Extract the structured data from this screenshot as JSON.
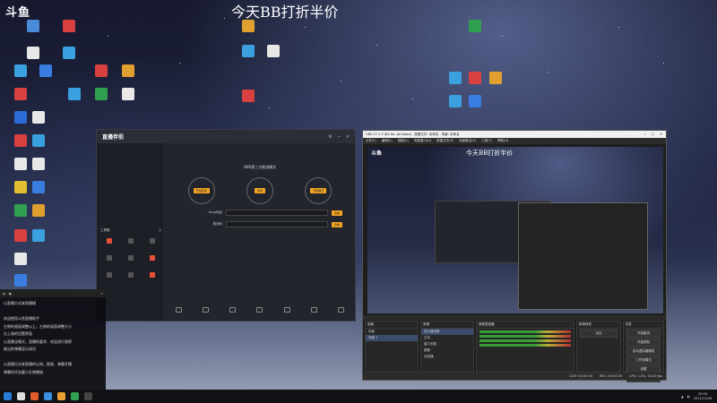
{
  "desktop": {
    "logo": "斗鱼",
    "stream_title": "今天BB打折半价"
  },
  "desktop_icons": [
    {
      "icon": "app-icon",
      "color": "#4a8bd8"
    },
    {
      "icon": "app-icon",
      "color": "#d94040"
    },
    {
      "icon": "app-icon",
      "color": "#e8e8e8"
    },
    {
      "icon": "app-icon",
      "color": "#3aa0e0"
    },
    {
      "icon": "app-icon",
      "color": "#d94040"
    },
    {
      "icon": "app-icon",
      "color": "#e0a030"
    },
    {
      "icon": "app-icon",
      "color": "#3aa0e0"
    },
    {
      "icon": "app-icon",
      "color": "#3a7de0"
    },
    {
      "icon": "app-icon",
      "color": "#30a050"
    },
    {
      "icon": "app-icon",
      "color": "#e8e8e8"
    },
    {
      "icon": "app-icon",
      "color": "#d94040"
    },
    {
      "icon": "app-icon",
      "color": "#3aa0e0"
    },
    {
      "icon": "app-icon",
      "color": "#2b6cd6"
    },
    {
      "icon": "app-icon",
      "color": "#e8e8e8"
    },
    {
      "icon": "app-icon",
      "color": "#d94040"
    },
    {
      "icon": "app-icon",
      "color": "#3aa0e0"
    },
    {
      "icon": "app-icon",
      "color": "#e8e8e8"
    },
    {
      "icon": "app-icon",
      "color": "#e8e8e8"
    },
    {
      "icon": "app-icon",
      "color": "#e0c030"
    },
    {
      "icon": "app-icon",
      "color": "#3a7de0"
    },
    {
      "icon": "app-icon",
      "color": "#30a050"
    },
    {
      "icon": "app-icon",
      "color": "#e0a030"
    },
    {
      "icon": "app-icon",
      "color": "#d94040"
    },
    {
      "icon": "app-icon",
      "color": "#3aa0e0"
    },
    {
      "icon": "app-icon",
      "color": "#e8e8e8"
    },
    {
      "icon": "app-icon",
      "color": "#3a7de0"
    },
    {
      "icon": "app-icon",
      "color": "#e0a030"
    },
    {
      "icon": "app-icon",
      "color": "#3aa0e0"
    },
    {
      "icon": "app-icon",
      "color": "#e8e8e8"
    },
    {
      "icon": "app-icon",
      "color": "#d94040"
    },
    {
      "icon": "app-icon",
      "color": "#30a050"
    }
  ],
  "streaming_app": {
    "logo": "直播伴侣",
    "mode_title": "OBS第三方推流模式",
    "steps": [
      {
        "button": "开始直播"
      },
      {
        "button": "复制"
      },
      {
        "button": "开始推流"
      }
    ],
    "fields": [
      {
        "key": "rtmp地址",
        "button": "复制"
      },
      {
        "key": "推流码",
        "button": "复制"
      }
    ],
    "tools_title": "工具箱"
  },
  "obs": {
    "title": "OBS 27.1.3 (64-bit, windows) - 配置文件: 未命名 - 场景: 未命名",
    "menu": [
      "文件(F)",
      "编辑(E)",
      "视图(V)",
      "停靠窗口(D)",
      "配置文件(P)",
      "场景集合(S)",
      "工具(T)",
      "帮助(H)"
    ],
    "preview_title": "今天BB打折半价",
    "preview_logo": "斗鱼",
    "docks": {
      "scenes_header": "场景",
      "scenes": [
        "场景",
        "场景 2"
      ],
      "sources_header": "来源",
      "sources": [
        "显示器采集",
        "文本",
        "窗口采集",
        "图像",
        "浏览器"
      ],
      "mixer_header": "音频混音器",
      "transitions_header": "转场特效",
      "transition_value": "淡出",
      "controls_header": "控件",
      "controls": [
        "开始推流",
        "开始录制",
        "启动虚拟摄像机",
        "工作室模式",
        "设置",
        "退出"
      ]
    },
    "status": [
      "LIVE: 00:00:00",
      "REC: 00:00:00",
      "CPU: 1.0%, 30.00 fps"
    ]
  },
  "chat": {
    "lines": [
      "以直播方式来直播模",
      "",
      "欢迎使用斗鱼直播助手",
      "左侧的画面调整以上，左侧的画面调整大小",
      "右上角的设置界面",
      "以直播全模式，直播的要求、欢迎进行观察",
      "推出的弹幕显示成功",
      "",
      "以直播方式来直播的认知、图表、弹幕开播",
      "弹幕的开启要小礼物播放"
    ]
  },
  "taskbar": {
    "time": "20:05",
    "date": "2021/11/26"
  }
}
